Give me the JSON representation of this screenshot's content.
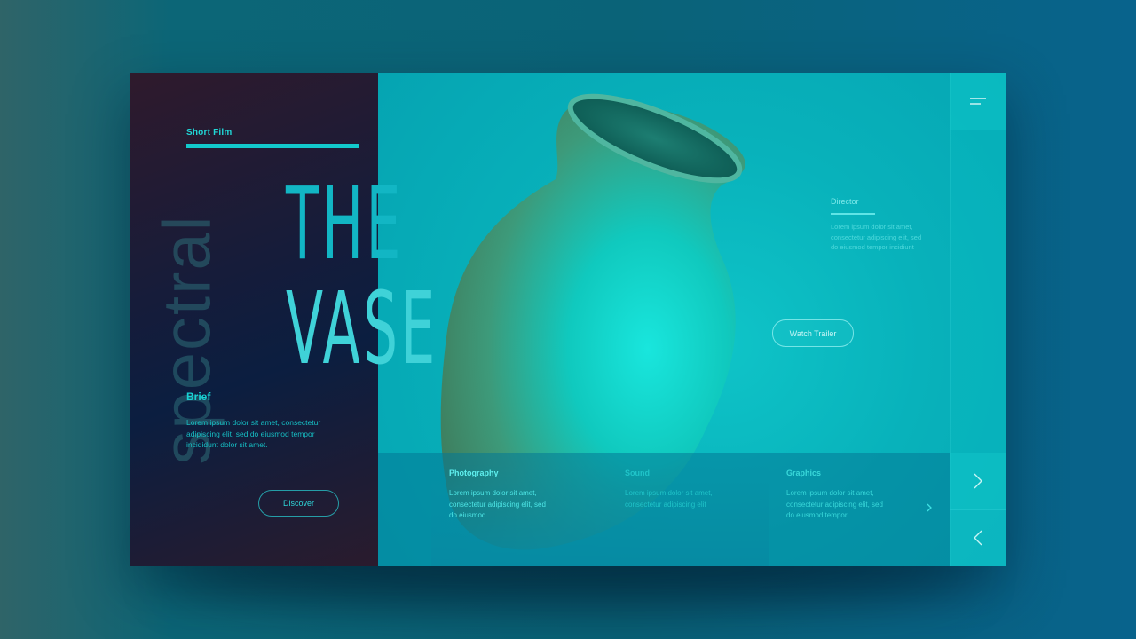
{
  "film": {
    "category": "Short Film",
    "vertical_word": "spectral",
    "title_line1": "THE",
    "title_line2": "VASE"
  },
  "brief": {
    "heading": "Brief",
    "body": "Lorem ipsum dolor sit amet, consectetur adipiscing elit, sed do eiusmod tempor incididunt dolor sit amet."
  },
  "director": {
    "heading": "Director",
    "body": "Lorem ipsum dolor sit amet, consectetur adipiscing elit, sed do eiusmod tempor incidiunt"
  },
  "actions": {
    "discover": "Discover",
    "watch_trailer": "Watch Trailer"
  },
  "features": [
    {
      "title": "Photography",
      "body": "Lorem ipsum dolor sit amet, consectetur adipiscing elit, sed do eiusmod"
    },
    {
      "title": "Sound",
      "body": "Lorem ipsum dolor sit amet, consectetur adipiscing elit"
    },
    {
      "title": "Graphics",
      "body": "Lorem ipsum dolor sit amet, consectetur adipiscing elit, sed do eiusmod tempor"
    }
  ],
  "icons": {
    "menu": "hamburger-menu-icon",
    "next": "chevron-right-icon",
    "prev": "chevron-left-icon",
    "features_more": "chevron-right-icon"
  },
  "colors": {
    "accent": "#12c9cc",
    "panel_dark": "#161c3a",
    "panel_teal": "#08b2bb"
  }
}
